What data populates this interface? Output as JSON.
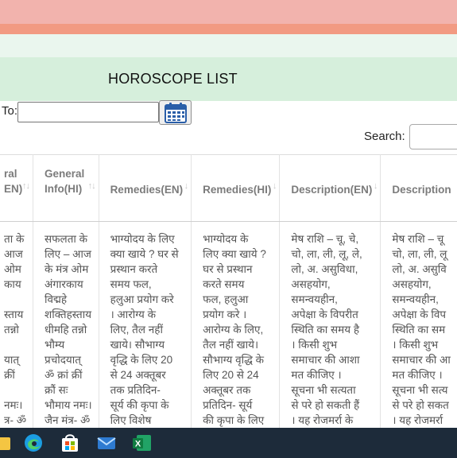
{
  "header": {
    "title": "HOROSCOPE LIST"
  },
  "filter": {
    "to_label": "To:",
    "to_value": ""
  },
  "search": {
    "label": "Search:",
    "value": ""
  },
  "table": {
    "columns": [
      {
        "label": "ral\nEN)",
        "partial": true
      },
      {
        "label": "General\nInfo(HI)"
      },
      {
        "label": "Remedies(EN)"
      },
      {
        "label": "Remedies(HI)"
      },
      {
        "label": "Description(EN)"
      },
      {
        "label": "Description",
        "partial": true
      }
    ],
    "row": [
      "ता के\nआज\nओम\nकाय\n\nस्ताय\nतन्नो\n\nयात्\nक्रीं\n\nनमः।\nत्र- ॐ",
      "सफलता के\nलिए – आज\nके मंत्र ओम\nअंगारकाय\nविद्महे\nशक्तिहस्ताय\nधीमहि तन्नो\nभौम्य\nप्रचोदयात्\nॐ क्रां क्रीं\nक्रौं सः\nभौमाय नमः।\nजैन मंत्र- ॐ\nह्रीं णमो",
      "भाग्योदय के लिए\nक्या खाये ? घर से\nप्रस्थान करते\nसमय फल,\nहलुआ प्रयोग करे\n। आरोग्य के\nलिए, तैल नहीं\nखाये। सौभाग्य\nवृद्धि के लिए 20\nसे 24 अक्तूबर\nतक प्रतिदिन-\nसूर्य की कृपा के\nलिए विशेष\nआपत्ति विपत्ति",
      "भाग्योदय के\nलिए क्या खाये ?\nघर से प्रस्थान\nकरते समय\nफल, हलुआ\nप्रयोग करे ।\nआरोग्य के लिए,\nतैल नहीं खाये।\nसौभाग्य वृद्धि के\nलिए 20 से 24\nअक्तूबर तक\nप्रतिदिन- सूर्य\nकी कृपा के लिए\nविशेष आपत्ति",
      "मेष राशि – चू, चे,\nचो, ला, ली, लू, ले,\nलो, अ. असुविधा,\nअसहयोग,\nसमन्वयहीन,\nअपेक्षा के विपरीत\nस्थिति का समय है\n। किसी शुभ\nसमाचार की आशा\nमत कीजिए ।\nसूचना भी सत्यता\nसे परे हो सकती हैं\n। यह रोजमर्रा के\nजीवन में",
      "मेष राशि – चू\nचो, ला, ली, लू\nलो, अ. असुवि\nअसहयोग,\nसमन्वयहीन,\nअपेक्षा के विप\nस्थिति का सम\n। किसी शुभ\nसमाचार की आ\nमत कीजिए ।\nसूचना भी सत्य\nसे परे हो सकत\n। यह रोजमर्रा\nजीवन में"
    ]
  },
  "taskbar": {
    "icons": [
      "folder-icon",
      "edge-icon",
      "store-icon",
      "mail-icon",
      "excel-icon"
    ],
    "excel_letter": "X"
  }
}
